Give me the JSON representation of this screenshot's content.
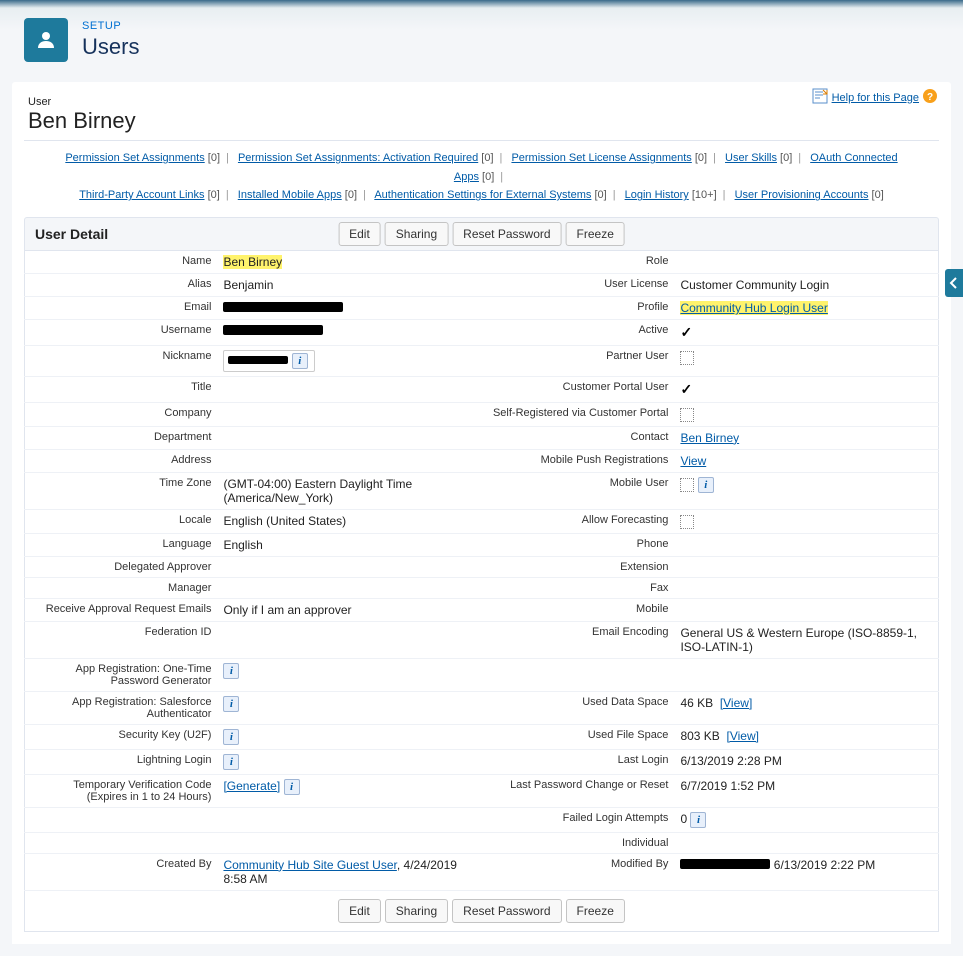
{
  "header": {
    "setup_label": "SETUP",
    "title": "Users"
  },
  "help": {
    "text": "Help for this Page"
  },
  "breadcrumb": {
    "entity": "User",
    "name": "Ben Birney"
  },
  "related_links": {
    "items": [
      {
        "label": "Permission Set Assignments",
        "count": "[0]"
      },
      {
        "label": "Permission Set Assignments: Activation Required",
        "count": "[0]"
      },
      {
        "label": "Permission Set License Assignments",
        "count": "[0]"
      },
      {
        "label": "User Skills",
        "count": "[0]"
      },
      {
        "label": "OAuth Connected Apps",
        "count": "[0]"
      },
      {
        "label": "Third-Party Account Links",
        "count": "[0]"
      },
      {
        "label": "Installed Mobile Apps",
        "count": "[0]"
      },
      {
        "label": "Authentication Settings for External Systems",
        "count": "[0]"
      },
      {
        "label": "Login History",
        "count": "[10+]"
      },
      {
        "label": "User Provisioning Accounts",
        "count": "[0]"
      }
    ]
  },
  "section": {
    "title": "User Detail"
  },
  "buttons": {
    "edit": "Edit",
    "sharing": "Sharing",
    "reset_password": "Reset Password",
    "freeze": "Freeze",
    "generate": "[Generate]",
    "view": "[View]",
    "view_plain": "View"
  },
  "labels": {
    "name": "Name",
    "alias": "Alias",
    "email": "Email",
    "username": "Username",
    "nickname": "Nickname",
    "title": "Title",
    "company": "Company",
    "department": "Department",
    "address": "Address",
    "time_zone": "Time Zone",
    "locale": "Locale",
    "language": "Language",
    "delegated_approver": "Delegated Approver",
    "manager": "Manager",
    "receive_approval": "Receive Approval Request Emails",
    "federation_id": "Federation ID",
    "app_reg_otp": "App Registration: One-Time Password Generator",
    "app_reg_sf": "App Registration: Salesforce Authenticator",
    "security_key": "Security Key (U2F)",
    "lightning_login": "Lightning Login",
    "temp_verify": "Temporary Verification Code (Expires in 1 to 24 Hours)",
    "created_by": "Created By",
    "role": "Role",
    "user_license": "User License",
    "profile": "Profile",
    "active": "Active",
    "partner_user": "Partner User",
    "customer_portal_user": "Customer Portal User",
    "self_registered": "Self-Registered via Customer Portal",
    "contact": "Contact",
    "mobile_push": "Mobile Push Registrations",
    "mobile_user": "Mobile User",
    "allow_forecasting": "Allow Forecasting",
    "phone": "Phone",
    "extension": "Extension",
    "fax": "Fax",
    "mobile": "Mobile",
    "email_encoding": "Email Encoding",
    "used_data_space": "Used Data Space",
    "used_file_space": "Used File Space",
    "last_login": "Last Login",
    "last_pw_change": "Last Password Change or Reset",
    "failed_login": "Failed Login Attempts",
    "individual": "Individual",
    "modified_by": "Modified By"
  },
  "values": {
    "name": "Ben Birney",
    "alias": "Benjamin",
    "time_zone": "(GMT-04:00) Eastern Daylight Time (America/New_York)",
    "locale": "English (United States)",
    "language": "English",
    "receive_approval": "Only if I am an approver",
    "user_license": "Customer Community Login",
    "profile": "Community Hub Login User",
    "contact": "Ben Birney",
    "email_encoding": "General US & Western Europe (ISO-8859-1, ISO-LATIN-1)",
    "used_data": "46 KB",
    "used_file": "803 KB",
    "last_login": "6/13/2019 2:28 PM",
    "last_pw_change": "6/7/2019 1:52 PM",
    "failed_login": "0",
    "created_by_name": "Community Hub Site Guest User",
    "created_by_date": ", 4/24/2019 8:58 AM",
    "modified_by_date": "6/13/2019 2:22 PM"
  }
}
